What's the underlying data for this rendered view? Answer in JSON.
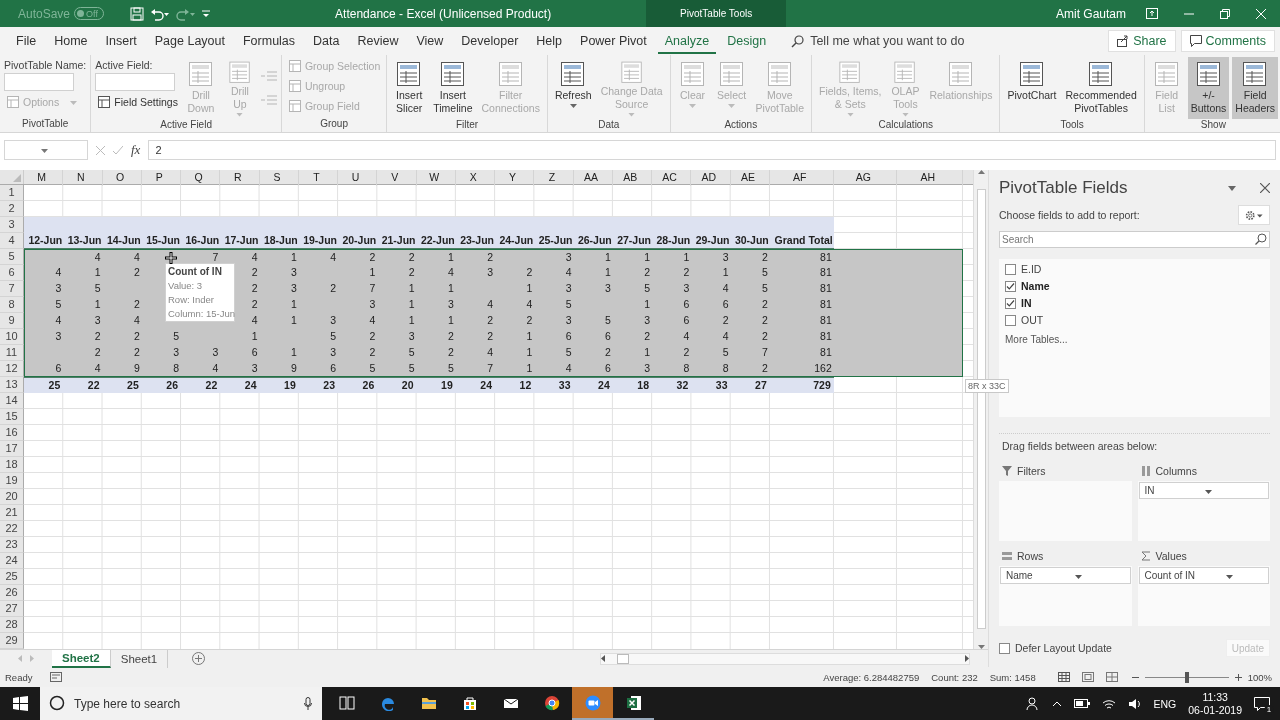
{
  "title_bar": {
    "autosave": {
      "label": "AutoSave",
      "on": false,
      "state_text": "Off"
    },
    "title": "Attendance  -  Excel (Unlicensed Product)",
    "context_tab": "PivotTable Tools",
    "user": "Amit Gautam"
  },
  "menu_tabs": [
    {
      "label": "File",
      "selected": false,
      "contextual": false
    },
    {
      "label": "Home",
      "selected": false,
      "contextual": false
    },
    {
      "label": "Insert",
      "selected": false,
      "contextual": false
    },
    {
      "label": "Page Layout",
      "selected": false,
      "contextual": false
    },
    {
      "label": "Formulas",
      "selected": false,
      "contextual": false
    },
    {
      "label": "Data",
      "selected": false,
      "contextual": false
    },
    {
      "label": "Review",
      "selected": false,
      "contextual": false
    },
    {
      "label": "View",
      "selected": false,
      "contextual": false
    },
    {
      "label": "Developer",
      "selected": false,
      "contextual": false
    },
    {
      "label": "Help",
      "selected": false,
      "contextual": false
    },
    {
      "label": "Power Pivot",
      "selected": false,
      "contextual": false
    },
    {
      "label": "Analyze",
      "selected": true,
      "contextual": true
    },
    {
      "label": "Design",
      "selected": false,
      "contextual": true
    }
  ],
  "tell_me": "Tell me what you want to do",
  "share": "Share",
  "comments": "Comments",
  "ribbon_groups": [
    {
      "label": "PivotTable",
      "columns": [
        [
          {
            "kind": "label",
            "text": "PivotTable Name:"
          },
          {
            "kind": "input"
          },
          {
            "kind": "small",
            "text": "Options",
            "disabled": true,
            "dropdown": true
          }
        ]
      ]
    },
    {
      "label": "Active Field",
      "columns": [
        [
          {
            "kind": "label",
            "text": "Active Field:"
          },
          {
            "kind": "input"
          },
          {
            "kind": "small",
            "text": "Field Settings",
            "disabled": false,
            "dropdown": false
          }
        ],
        [
          {
            "kind": "large",
            "text": "Drill\nDown",
            "disabled": true,
            "dropdown": false,
            "pressed": false
          }
        ],
        [
          {
            "kind": "large",
            "text": "Drill\nUp",
            "disabled": true,
            "dropdown": true,
            "pressed": false
          }
        ],
        [
          {
            "kind": "icon",
            "disabled": true
          },
          {
            "kind": "icon",
            "disabled": true
          }
        ]
      ]
    },
    {
      "label": "Group",
      "columns": [
        [
          {
            "kind": "small",
            "text": "Group Selection",
            "disabled": true,
            "dropdown": false
          },
          {
            "kind": "small",
            "text": "Ungroup",
            "disabled": true,
            "dropdown": false
          },
          {
            "kind": "small",
            "text": "Group Field",
            "disabled": true,
            "dropdown": false
          }
        ]
      ]
    },
    {
      "label": "Filter",
      "columns": [
        [
          {
            "kind": "large",
            "text": "Insert\nSlicer",
            "disabled": false,
            "dropdown": false,
            "pressed": false
          }
        ],
        [
          {
            "kind": "large",
            "text": "Insert\nTimeline",
            "disabled": false,
            "dropdown": false,
            "pressed": false
          }
        ],
        [
          {
            "kind": "large",
            "text": "Filter\nConnections",
            "disabled": true,
            "dropdown": false,
            "pressed": false
          }
        ]
      ]
    },
    {
      "label": "Data",
      "columns": [
        [
          {
            "kind": "large",
            "text": "Refresh",
            "disabled": false,
            "dropdown": true,
            "pressed": false
          }
        ],
        [
          {
            "kind": "large",
            "text": "Change Data\nSource",
            "disabled": true,
            "dropdown": true,
            "pressed": false
          }
        ]
      ]
    },
    {
      "label": "Actions",
      "columns": [
        [
          {
            "kind": "large",
            "text": "Clear",
            "disabled": true,
            "dropdown": true,
            "pressed": false
          }
        ],
        [
          {
            "kind": "large",
            "text": "Select",
            "disabled": true,
            "dropdown": true,
            "pressed": false
          }
        ],
        [
          {
            "kind": "large",
            "text": "Move\nPivotTable",
            "disabled": true,
            "dropdown": false,
            "pressed": false
          }
        ]
      ]
    },
    {
      "label": "Calculations",
      "columns": [
        [
          {
            "kind": "large",
            "text": "Fields, Items,\n& Sets",
            "disabled": true,
            "dropdown": true,
            "pressed": false
          }
        ],
        [
          {
            "kind": "large",
            "text": "OLAP\nTools",
            "disabled": true,
            "dropdown": true,
            "pressed": false
          }
        ],
        [
          {
            "kind": "large",
            "text": "Relationships",
            "disabled": true,
            "dropdown": false,
            "pressed": false
          }
        ]
      ]
    },
    {
      "label": "Tools",
      "columns": [
        [
          {
            "kind": "large",
            "text": "PivotChart",
            "disabled": false,
            "dropdown": false,
            "pressed": false
          }
        ],
        [
          {
            "kind": "large",
            "text": "Recommended\nPivotTables",
            "disabled": false,
            "dropdown": false,
            "pressed": false
          }
        ]
      ]
    },
    {
      "label": "Show",
      "columns": [
        [
          {
            "kind": "large",
            "text": "Field\nList",
            "disabled": true,
            "dropdown": false,
            "pressed": false
          }
        ],
        [
          {
            "kind": "large",
            "text": "+/-\nButtons",
            "disabled": false,
            "dropdown": false,
            "pressed": true
          }
        ],
        [
          {
            "kind": "large",
            "text": "Field\nHeaders",
            "disabled": false,
            "dropdown": false,
            "pressed": true
          }
        ]
      ]
    }
  ],
  "formula_bar": {
    "function_symbol": "fx",
    "value": "2"
  },
  "sheet": {
    "column_letters": [
      "M",
      "N",
      "O",
      "P",
      "Q",
      "R",
      "S",
      "T",
      "U",
      "V",
      "W",
      "X",
      "Y",
      "Z",
      "AA",
      "AB",
      "AC",
      "AD",
      "AE",
      "AF",
      "AG",
      "AH"
    ],
    "rows": [
      {
        "number": "1",
        "kind": "blank",
        "selected": false
      },
      {
        "number": "2",
        "kind": "blank",
        "selected": false
      },
      {
        "number": "3",
        "kind": "band",
        "selected": false
      },
      {
        "number": "4",
        "kind": "header",
        "selected": false,
        "cells": [
          "12-Jun",
          "13-Jun",
          "14-Jun",
          "15-Jun",
          "16-Jun",
          "17-Jun",
          "18-Jun",
          "19-Jun",
          "20-Jun",
          "21-Jun",
          "22-Jun",
          "23-Jun",
          "24-Jun",
          "25-Jun",
          "26-Jun",
          "27-Jun",
          "28-Jun",
          "29-Jun",
          "30-Jun",
          "Grand Total"
        ]
      },
      {
        "number": "5",
        "kind": "body",
        "selected": true,
        "cells": [
          "",
          "4",
          "4",
          "",
          "7",
          "4",
          "1",
          "4",
          "2",
          "2",
          "1",
          "2",
          "",
          "3",
          "1",
          "1",
          "1",
          "3",
          "2",
          "81"
        ]
      },
      {
        "number": "6",
        "kind": "body",
        "selected": true,
        "cells": [
          "4",
          "1",
          "2",
          "",
          "",
          "2",
          "3",
          "",
          "1",
          "2",
          "4",
          "3",
          "2",
          "4",
          "1",
          "2",
          "2",
          "1",
          "5",
          "81"
        ]
      },
      {
        "number": "7",
        "kind": "body",
        "selected": true,
        "cells": [
          "3",
          "5",
          "",
          "",
          "",
          "2",
          "3",
          "2",
          "7",
          "1",
          "1",
          "",
          "1",
          "3",
          "3",
          "5",
          "3",
          "4",
          "5",
          "81"
        ]
      },
      {
        "number": "8",
        "kind": "body",
        "selected": true,
        "cells": [
          "5",
          "1",
          "2",
          "",
          "",
          "2",
          "1",
          "",
          "3",
          "1",
          "3",
          "4",
          "4",
          "5",
          "",
          "1",
          "6",
          "6",
          "2",
          "81"
        ]
      },
      {
        "number": "9",
        "kind": "body",
        "selected": true,
        "cells": [
          "4",
          "3",
          "4",
          "",
          "",
          "4",
          "1",
          "3",
          "4",
          "1",
          "1",
          "2",
          "2",
          "3",
          "5",
          "3",
          "6",
          "2",
          "2",
          "81"
        ]
      },
      {
        "number": "10",
        "kind": "body",
        "selected": true,
        "cells": [
          "3",
          "2",
          "2",
          "5",
          "",
          "1",
          "",
          "5",
          "2",
          "3",
          "2",
          "2",
          "1",
          "6",
          "6",
          "2",
          "4",
          "4",
          "2",
          "81"
        ]
      },
      {
        "number": "11",
        "kind": "body",
        "selected": true,
        "cells": [
          "",
          "2",
          "2",
          "3",
          "3",
          "6",
          "1",
          "3",
          "2",
          "5",
          "2",
          "4",
          "1",
          "5",
          "2",
          "1",
          "2",
          "5",
          "7",
          "81"
        ]
      },
      {
        "number": "12",
        "kind": "body",
        "selected": true,
        "cells": [
          "6",
          "4",
          "9",
          "8",
          "4",
          "3",
          "9",
          "6",
          "5",
          "5",
          "5",
          "7",
          "1",
          "4",
          "6",
          "3",
          "8",
          "8",
          "2",
          "162"
        ]
      },
      {
        "number": "13",
        "kind": "total",
        "selected": false,
        "cells": [
          "25",
          "22",
          "25",
          "26",
          "22",
          "24",
          "19",
          "23",
          "26",
          "20",
          "19",
          "24",
          "12",
          "33",
          "24",
          "18",
          "32",
          "33",
          "27",
          "729"
        ]
      },
      {
        "number": "14",
        "kind": "blank",
        "selected": false
      },
      {
        "number": "15",
        "kind": "blank",
        "selected": false
      },
      {
        "number": "16",
        "kind": "blank",
        "selected": false
      },
      {
        "number": "17",
        "kind": "blank",
        "selected": false
      },
      {
        "number": "18",
        "kind": "blank",
        "selected": false
      },
      {
        "number": "19",
        "kind": "blank",
        "selected": false
      },
      {
        "number": "20",
        "kind": "blank",
        "selected": false
      },
      {
        "number": "21",
        "kind": "blank",
        "selected": false
      },
      {
        "number": "22",
        "kind": "blank",
        "selected": false
      },
      {
        "number": "23",
        "kind": "blank",
        "selected": false
      },
      {
        "number": "24",
        "kind": "blank",
        "selected": false
      },
      {
        "number": "25",
        "kind": "blank",
        "selected": false
      },
      {
        "number": "26",
        "kind": "blank",
        "selected": false
      },
      {
        "number": "27",
        "kind": "blank",
        "selected": false
      },
      {
        "number": "28",
        "kind": "blank",
        "selected": false
      },
      {
        "number": "29",
        "kind": "blank",
        "selected": false
      }
    ],
    "tooltip": {
      "title": "Count of IN",
      "lines": [
        "Value: 3",
        "Row: Inder",
        "Column: 15-Jun"
      ]
    },
    "selection_size": "8R x 33C"
  },
  "sheet_tabs": [
    {
      "label": "Sheet2",
      "selected": true
    },
    {
      "label": "Sheet1",
      "selected": false
    }
  ],
  "status_bar": {
    "mode": "Ready",
    "average": "Average: 6.284482759",
    "count": "Count: 232",
    "sum": "Sum: 1458",
    "zoom": {
      "level": 0.5,
      "reading": "100%"
    }
  },
  "pivot_pane": {
    "title": "PivotTable Fields",
    "subtitle": "Choose fields to add to report:",
    "search": {
      "placeholder": "Search"
    },
    "fields": [
      {
        "label": "E.ID",
        "checked": false
      },
      {
        "label": "Name",
        "checked": true
      },
      {
        "label": "IN",
        "checked": true
      },
      {
        "label": "OUT",
        "checked": false
      }
    ],
    "more_tables": "More Tables...",
    "drag_hint": "Drag fields between areas below:",
    "areas": [
      {
        "kind": "filters",
        "label": "Filters"
      },
      {
        "kind": "columns",
        "label": "Columns",
        "items": [
          "IN"
        ]
      },
      {
        "kind": "rows",
        "label": "Rows",
        "items": [
          "Name"
        ]
      },
      {
        "kind": "values",
        "label": "Values",
        "items": [
          "Count of IN"
        ]
      }
    ],
    "defer": {
      "label": "Defer Layout Update",
      "checked": false
    },
    "update": {
      "label": "Update",
      "disabled": true
    }
  },
  "taskbar": {
    "search": {
      "placeholder": "Type here to search"
    },
    "apps": [
      {
        "kind": "task-view",
        "highlighted": false,
        "running": false
      },
      {
        "kind": "edge",
        "highlighted": false,
        "running": false
      },
      {
        "kind": "explorer",
        "highlighted": false,
        "running": false
      },
      {
        "kind": "store",
        "highlighted": false,
        "running": false
      },
      {
        "kind": "mail",
        "highlighted": false,
        "running": false
      },
      {
        "kind": "chrome",
        "highlighted": false,
        "running": false
      },
      {
        "kind": "zoom",
        "highlighted": true,
        "running": true
      },
      {
        "kind": "excel",
        "highlighted": false,
        "running": true
      }
    ],
    "language": "ENG",
    "time": "11:33",
    "date": "06-01-2019",
    "notifications": "1"
  }
}
